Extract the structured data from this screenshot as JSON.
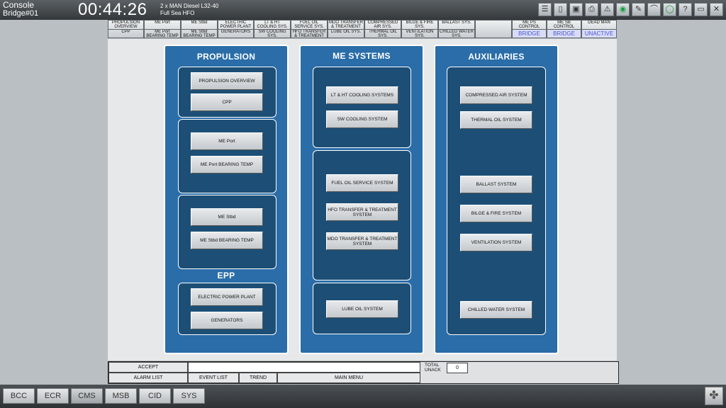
{
  "topbar": {
    "console": "Console",
    "station": "Bridge#01",
    "clock": "00:44:26",
    "engine_line1": "2 x MAN Diesel L32-40",
    "engine_line2": "Full Sea HFO",
    "icons": [
      "list-icon",
      "page-icon",
      "save-icon",
      "print-icon",
      "alarm-icon",
      "camera-icon",
      "edit-icon",
      "chart-icon",
      "chat-icon",
      "help-icon",
      "window-icon",
      "close-icon"
    ]
  },
  "navbar": {
    "buttons": [
      {
        "top": "PROPULSION OVERVIEW",
        "bottom": "CPP"
      },
      {
        "top": "ME Port",
        "bottom": "ME Port BEARING TEMP"
      },
      {
        "top": "ME Stbd",
        "bottom": "ME Stbd BEARING TEMP"
      },
      {
        "top": "ELECTRIC POWER PLANT",
        "bottom": "GENERATORS"
      },
      {
        "top": "LT & HT COOLING SYS.",
        "bottom": "SW COOLING SYS."
      },
      {
        "top": "FUEL OIL SERVICE SYS.",
        "bottom": "HFO TRANSFER & TREATMENT"
      },
      {
        "top": "MDO TRANSFER & TREATMENT",
        "bottom": "LUBE OIL SYS."
      },
      {
        "top": "COMPRESSED AIR SYS.",
        "bottom": "THERMAL OIL SYS."
      },
      {
        "top": "BILGE & FIRE SYS.",
        "bottom": "VENTILATION SYS."
      },
      {
        "top": "BALLAST SYS.",
        "bottom": "CHILLED WATER SYS."
      }
    ],
    "status": [
      {
        "label": "ME PS CONTROL",
        "value": "BRIDGE"
      },
      {
        "label": "ME SB CONTROL",
        "value": "BRIDGE"
      },
      {
        "label": "DEAD MAN",
        "value": "UNACTIVE"
      }
    ]
  },
  "panels": {
    "propulsion": {
      "title": "PROPULSION",
      "epp_title": "EPP",
      "overview": "PROPULSION OVERVIEW",
      "cpp": "CPP",
      "me_port": "ME Port",
      "me_port_bearing": "ME Port BEARING TEMP",
      "me_stbd": "ME Stbd",
      "me_stbd_bearing": "ME Stbd BEARING TEMP",
      "epp": "ELECTRIC POWER PLANT",
      "generators": "GENERATORS"
    },
    "me_systems": {
      "title": "ME SYSTEMS",
      "lt_ht": "LT & HT COOLING SYSTEMS",
      "sw": "SW COOLING SYSTEM",
      "fuel": "FUEL OIL SERVICE SYSTEM",
      "hfo": "HFO TRANSFER & TREATMENT SYSTEM",
      "mdo": "MDO TRANSFER & TREATMENT SYSTEM",
      "lube": "LUBE OIL SYSTEM"
    },
    "auxiliaries": {
      "title": "AUXILIARIES",
      "air": "COMPRESSED AIR SYSTEM",
      "thermal": "THERMAL OIL SYSTEM",
      "ballast": "BALLAST SYSTEM",
      "bilge": "BILGE & FIRE SYSTEM",
      "vent": "VENTILATION SYSTEM",
      "chilled": "CHILLED WATER SYSTEM"
    }
  },
  "alarmbar": {
    "accept": "ACCEPT",
    "alarm_list": "ALARM LIST",
    "event_list": "EVENT LIST",
    "trend": "TREND",
    "main_menu": "MAIN MENU",
    "total": "TOTAL",
    "unack": "UNACK",
    "count": "0"
  },
  "tabs": [
    "BCC",
    "ECR",
    "CMS",
    "MSB",
    "CID",
    "SYS"
  ],
  "active_tab": "CMS",
  "colors": {
    "panel": "#2a6da8",
    "group": "#1d4f76",
    "status": "#4a55d8"
  }
}
